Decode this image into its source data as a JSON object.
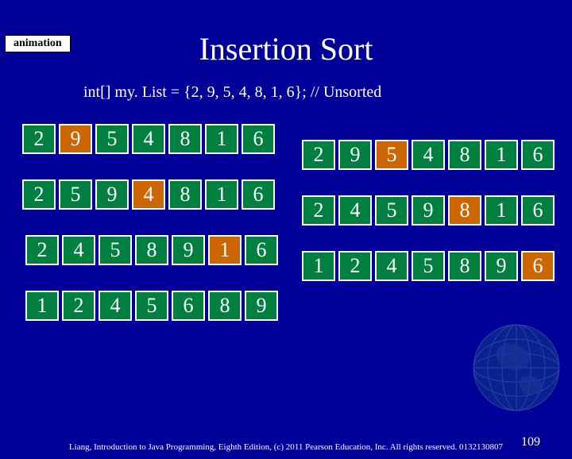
{
  "badge": "animation",
  "title": "Insertion Sort",
  "code_line": "int[] my. List = {2, 9, 5, 4, 8, 1, 6}; // Unsorted",
  "arrays": {
    "L1": [
      {
        "v": "2",
        "c": "green"
      },
      {
        "v": "9",
        "c": "orange"
      },
      {
        "v": "5",
        "c": "green"
      },
      {
        "v": "4",
        "c": "green"
      },
      {
        "v": "8",
        "c": "green"
      },
      {
        "v": "1",
        "c": "green"
      },
      {
        "v": "6",
        "c": "green"
      }
    ],
    "L2": [
      {
        "v": "2",
        "c": "green"
      },
      {
        "v": "5",
        "c": "green"
      },
      {
        "v": "9",
        "c": "green"
      },
      {
        "v": "4",
        "c": "orange"
      },
      {
        "v": "8",
        "c": "green"
      },
      {
        "v": "1",
        "c": "green"
      },
      {
        "v": "6",
        "c": "green"
      }
    ],
    "L3": [
      {
        "v": "2",
        "c": "green"
      },
      {
        "v": "4",
        "c": "green"
      },
      {
        "v": "5",
        "c": "green"
      },
      {
        "v": "8",
        "c": "green"
      },
      {
        "v": "9",
        "c": "green"
      },
      {
        "v": "1",
        "c": "orange"
      },
      {
        "v": "6",
        "c": "green"
      }
    ],
    "L4": [
      {
        "v": "1",
        "c": "green"
      },
      {
        "v": "2",
        "c": "green"
      },
      {
        "v": "4",
        "c": "green"
      },
      {
        "v": "5",
        "c": "green"
      },
      {
        "v": "6",
        "c": "green"
      },
      {
        "v": "8",
        "c": "green"
      },
      {
        "v": "9",
        "c": "green"
      }
    ],
    "R1": [
      {
        "v": "2",
        "c": "green"
      },
      {
        "v": "9",
        "c": "green"
      },
      {
        "v": "5",
        "c": "orange"
      },
      {
        "v": "4",
        "c": "green"
      },
      {
        "v": "8",
        "c": "green"
      },
      {
        "v": "1",
        "c": "green"
      },
      {
        "v": "6",
        "c": "green"
      }
    ],
    "R2": [
      {
        "v": "2",
        "c": "green"
      },
      {
        "v": "4",
        "c": "green"
      },
      {
        "v": "5",
        "c": "green"
      },
      {
        "v": "9",
        "c": "green"
      },
      {
        "v": "8",
        "c": "orange"
      },
      {
        "v": "1",
        "c": "green"
      },
      {
        "v": "6",
        "c": "green"
      }
    ],
    "R3": [
      {
        "v": "1",
        "c": "green"
      },
      {
        "v": "2",
        "c": "green"
      },
      {
        "v": "4",
        "c": "green"
      },
      {
        "v": "5",
        "c": "green"
      },
      {
        "v": "8",
        "c": "green"
      },
      {
        "v": "9",
        "c": "green"
      },
      {
        "v": "6",
        "c": "orange"
      }
    ]
  },
  "footer": "Liang, Introduction to Java Programming, Eighth Edition, (c) 2011 Pearson Education, Inc. All rights reserved. 0132130807",
  "page_num": "109"
}
